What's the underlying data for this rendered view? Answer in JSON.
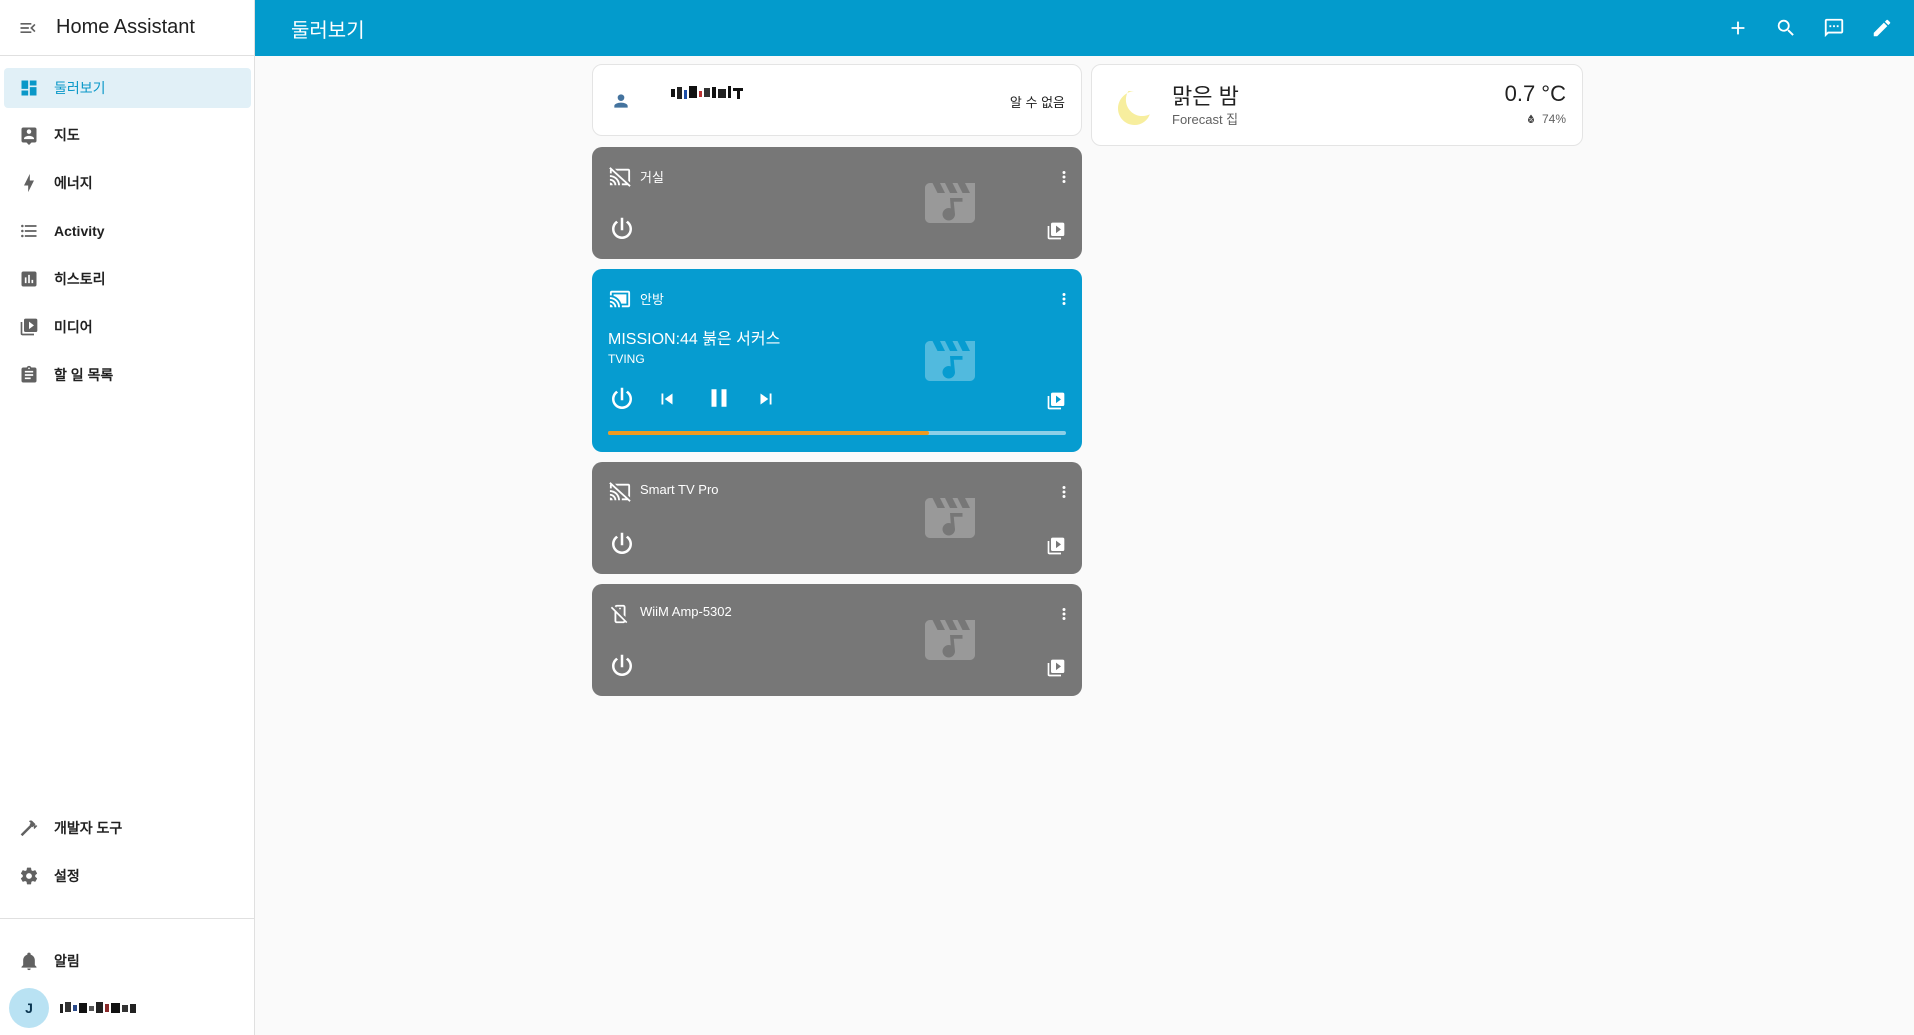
{
  "app": {
    "title": "Home Assistant"
  },
  "sidebar": {
    "items": [
      {
        "label": "둘러보기",
        "icon": "dashboard-icon",
        "active": true
      },
      {
        "label": "지도",
        "icon": "map-icon"
      },
      {
        "label": "에너지",
        "icon": "lightning-bolt-icon"
      },
      {
        "label": "Activity",
        "icon": "list-icon"
      },
      {
        "label": "히스토리",
        "icon": "chart-box-icon"
      },
      {
        "label": "미디어",
        "icon": "play-box-multiple-icon"
      },
      {
        "label": "할 일 목록",
        "icon": "clipboard-list-icon"
      }
    ],
    "bottom_items": [
      {
        "label": "개발자 도구",
        "icon": "hammer-icon"
      },
      {
        "label": "설정",
        "icon": "cog-icon"
      }
    ],
    "notifications": {
      "label": "알림",
      "icon": "bell-icon"
    },
    "user": {
      "avatar_initial": "J",
      "name": "",
      "name_redacted": true
    }
  },
  "header": {
    "title": "둘러보기",
    "actions": [
      "plus-icon",
      "search-icon",
      "assist-icon",
      "pencil-icon"
    ]
  },
  "person_card": {
    "name": "",
    "name_redacted": true,
    "state": "알 수 없음",
    "icon": "account-icon"
  },
  "weather_card": {
    "condition": "맑은 밤",
    "subtitle": "Forecast 집",
    "temperature": "0.7 °C",
    "humidity": "74%",
    "icon": "moon-icon"
  },
  "media_players": [
    {
      "name": "거실",
      "state": "off",
      "icon": "cast-off-icon"
    },
    {
      "name": "안방",
      "state": "playing",
      "title": "MISSION:44 붉은 서커스",
      "artist": "TVING",
      "progress": 0.7,
      "icon": "cast-connected-icon"
    },
    {
      "name": "Smart TV Pro",
      "state": "off",
      "icon": "cast-off-icon"
    },
    {
      "name": "WiiM Amp-5302",
      "state": "off",
      "icon": "speaker-off-icon"
    }
  ],
  "colors": {
    "primary": "#039BCC",
    "active_card": "#069CD0",
    "off_card": "#777777",
    "progress": "#EF9A1F",
    "sidebar_active_bg": "#E1F0F7",
    "weather_moon": "#F7EE9E"
  }
}
